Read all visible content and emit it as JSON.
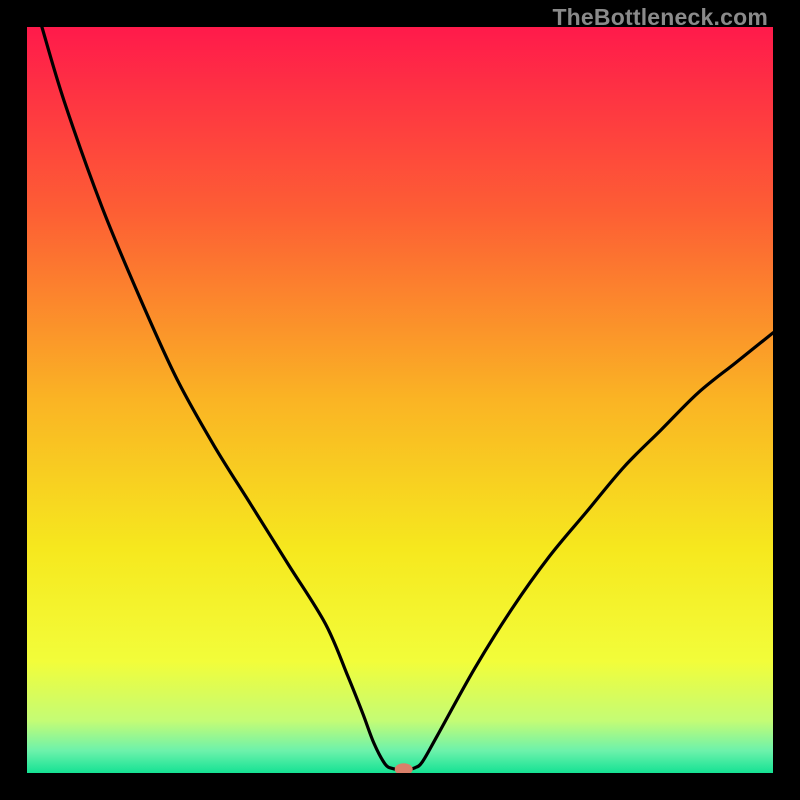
{
  "watermark": "TheBottleneck.com",
  "chart_data": {
    "type": "line",
    "title": "",
    "xlabel": "",
    "ylabel": "",
    "xlim": [
      0,
      100
    ],
    "ylim": [
      0,
      100
    ],
    "grid": false,
    "legend": false,
    "series": [
      {
        "name": "curve",
        "color": "#000000",
        "x": [
          2,
          5,
          10,
          15,
          20,
          25,
          30,
          35,
          40,
          43,
          45,
          46.5,
          48,
          49,
          50,
          51,
          52,
          53,
          55,
          60,
          65,
          70,
          75,
          80,
          85,
          90,
          95,
          100
        ],
        "y": [
          100,
          90,
          76,
          64,
          53,
          44,
          36,
          28,
          20,
          13,
          8,
          4,
          1.2,
          0.6,
          0.5,
          0.5,
          0.7,
          1.5,
          5,
          14,
          22,
          29,
          35,
          41,
          46,
          51,
          55,
          59
        ]
      }
    ],
    "background_gradient": {
      "stops": [
        {
          "offset": 0.0,
          "color": "#ff1a4b"
        },
        {
          "offset": 0.25,
          "color": "#fd5f34"
        },
        {
          "offset": 0.5,
          "color": "#fab424"
        },
        {
          "offset": 0.7,
          "color": "#f6e81e"
        },
        {
          "offset": 0.85,
          "color": "#f2fd3a"
        },
        {
          "offset": 0.93,
          "color": "#c4fc75"
        },
        {
          "offset": 0.97,
          "color": "#6df2ab"
        },
        {
          "offset": 1.0,
          "color": "#15e294"
        }
      ]
    },
    "marker": {
      "x": 50.5,
      "y": 0.5,
      "color": "#d9806a",
      "rx": 9,
      "ry": 6
    }
  }
}
